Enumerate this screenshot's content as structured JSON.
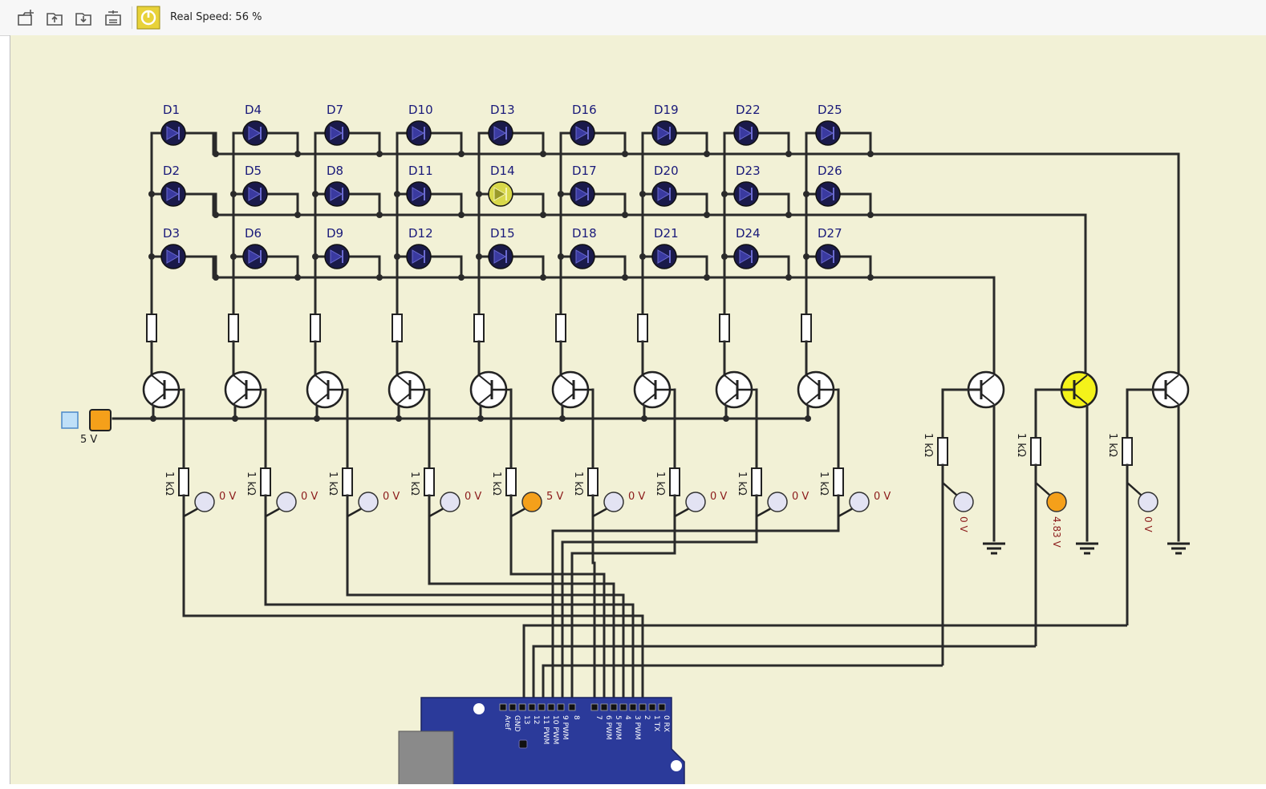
{
  "toolbar": {
    "buttons": [
      {
        "name": "new-circuit-button",
        "icon": "new-file-icon"
      },
      {
        "name": "open-circuit-button",
        "icon": "open-folder-icon"
      },
      {
        "name": "save-circuit-button",
        "icon": "save-folder-icon"
      },
      {
        "name": "settings-button",
        "icon": "circuit-settings-icon"
      }
    ],
    "power_button": {
      "icon": "power-icon",
      "color": "#e8d23a"
    },
    "speed_label": "Real Speed: 56 %"
  },
  "colors": {
    "background": "#f2f1d6",
    "wire": "#2a2a2a",
    "led_off": "#1a1a4a",
    "led_on": "#d8d84a",
    "probe_off": "#e3e3f3",
    "probe_on": "#f5a01a",
    "voltage_text": "#8b1a1a",
    "label_text": "#1a1a7a",
    "arduino_board": "#2b3a9a",
    "transistor_on": "#f4f21a"
  },
  "leds": {
    "rows": [
      [
        "D1",
        "D4",
        "D7",
        "D10",
        "D13",
        "D16",
        "D19",
        "D22",
        "D25"
      ],
      [
        "D2",
        "D5",
        "D8",
        "D11",
        "D14",
        "D17",
        "D20",
        "D23",
        "D26"
      ],
      [
        "D3",
        "D6",
        "D9",
        "D12",
        "D15",
        "D18",
        "D21",
        "D24",
        "D27"
      ]
    ],
    "lit": [
      "D14"
    ]
  },
  "supply": {
    "label": "5 V"
  },
  "column_drivers": {
    "resistor_label": "1 kΩ",
    "probe_voltages": [
      "0 V",
      "0 V",
      "0 V",
      "0 V",
      "5 V",
      "0 V",
      "0 V",
      "0 V",
      "0 V"
    ],
    "active_index": 4
  },
  "layer_drivers": {
    "resistor_label": "1 kΩ",
    "probe_voltages": [
      "0 V",
      "4.83 V",
      "0 V"
    ],
    "active_index": 1
  },
  "arduino": {
    "header_pins_left": [
      "Aref",
      "GND",
      "13",
      "12",
      "11 PWM",
      "10 PWM",
      "9 PWM",
      "8"
    ],
    "header_pins_right": [
      "7",
      "6 PWM",
      "5 PWM",
      "4",
      "3 PWM",
      "2",
      "1 TX",
      "0 RX"
    ]
  }
}
